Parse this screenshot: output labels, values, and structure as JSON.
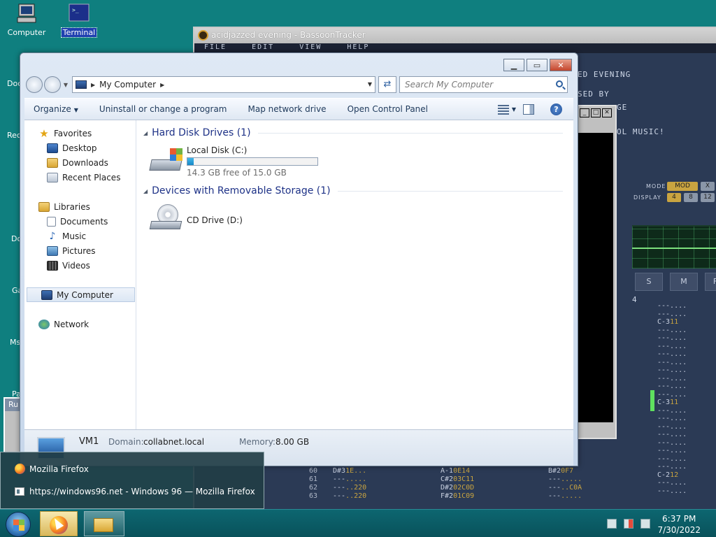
{
  "desktop": {
    "icons": [
      {
        "label": "Computer"
      },
      {
        "label": "Terminal"
      }
    ],
    "edge_labels": [
      "Doc",
      "Rec",
      "Do",
      "Ga",
      "Ms",
      "Pa"
    ]
  },
  "tracker": {
    "title": "acidjazzed evening - BassoonTracker",
    "menu": [
      "FILE",
      "EDIT",
      "VIEW",
      "HELP"
    ],
    "side_lines": [
      "ED EVENING",
      "SED BY",
      "GE",
      "OL MUSIC!"
    ],
    "mode_label": "MODE",
    "display_label": "DISPLAY",
    "mode_value": "MOD",
    "mode_extra": "X",
    "display_values": [
      "4",
      "8",
      "12"
    ],
    "channel_buttons": [
      "S",
      "M",
      "F"
    ],
    "track_number": "4",
    "pattern_rows": [
      {
        "num": "60",
        "c1": "D#3",
        "c1a": "1E...",
        "c2": "A-1",
        "c2a": "0E14",
        "c3": "B#2",
        "c3a": "0F7"
      },
      {
        "num": "61",
        "c1": "---",
        "c1a": ".....",
        "c2": "C#2",
        "c2a": "03C11",
        "c3": "---",
        "c3a": "....."
      },
      {
        "num": "62",
        "c1": "---",
        "c1a": "..220",
        "c2": "D#2",
        "c2a": "02C0D",
        "c3": "---",
        "c3a": "..C0A"
      },
      {
        "num": "63",
        "c1": "---",
        "c1a": "..220",
        "c2": "F#2",
        "c2a": "01C09",
        "c3": "---",
        "c3a": "....."
      }
    ],
    "note_a": "C-3",
    "note_a_inst": "11",
    "note_b": "C-3",
    "note_b_inst": "11",
    "note_c": "C-2",
    "note_c_inst": "12"
  },
  "explorer": {
    "address": "My Computer",
    "search_placeholder": "Search My Computer",
    "toolbar": {
      "organize": "Organize",
      "uninstall": "Uninstall or change a program",
      "map_drive": "Map network drive",
      "control_panel": "Open Control Panel"
    },
    "nav": {
      "favorites": "Favorites",
      "desktop": "Desktop",
      "downloads": "Downloads",
      "recent": "Recent Places",
      "libraries": "Libraries",
      "documents": "Documents",
      "music": "Music",
      "pictures": "Pictures",
      "videos": "Videos",
      "my_computer": "My Computer",
      "network": "Network"
    },
    "groups": {
      "hdd_header": "Hard Disk Drives (1)",
      "removable_header": "Devices with Removable Storage (1)"
    },
    "drives": {
      "local_name": "Local Disk (C:)",
      "local_free": "14.3 GB free of 15.0 GB",
      "local_used_fraction": 0.047,
      "cd_name": "CD Drive (D:)"
    },
    "details": {
      "name": "VM1",
      "domain_label": "Domain:",
      "domain_value": "collabnet.local",
      "memory_label": "Memory:",
      "memory_value": "8.00 GB"
    }
  },
  "run_box": {
    "title": "Ru"
  },
  "preview": {
    "app_title": "Mozilla Firefox",
    "page_title": "https://windows96.net - Windows 96 — Mozilla Firefox"
  },
  "clock": {
    "time": "6:37 PM",
    "date": "7/30/2022"
  }
}
